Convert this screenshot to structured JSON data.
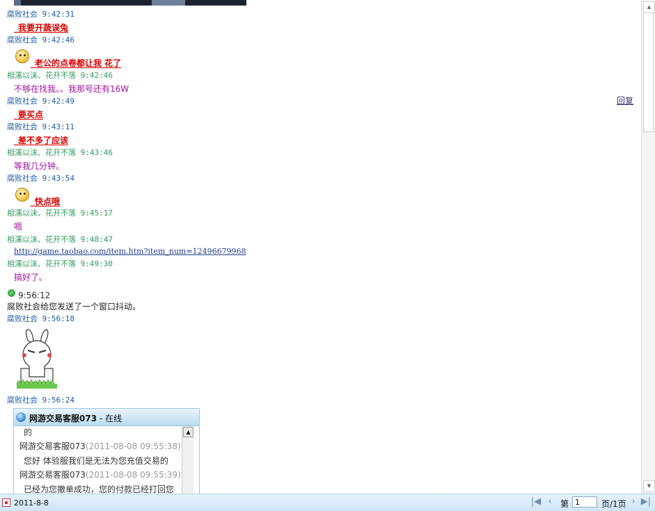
{
  "messages": [
    {
      "sender": "腐败社会",
      "time": "9:42:31",
      "text": "_我要开蔬误兔",
      "style": "red"
    },
    {
      "sender": "腐败社会",
      "time": "9:42:46",
      "text": "_老公的点卷都让我 花了",
      "style": "red",
      "emoji": "sad-face"
    },
    {
      "sender": "相濡以沫、花开不落",
      "time": "9:42:46",
      "text": "不够在找我。。我那号还有16W",
      "style": "pink"
    },
    {
      "sender": "腐败社会",
      "time": "9:42:49",
      "text": "_要买点",
      "style": "red"
    },
    {
      "sender": "腐败社会",
      "time": "9:43:11",
      "text": "_差不多了应该",
      "style": "red"
    },
    {
      "sender": "相濡以沫、花开不落",
      "time": "9:43:46",
      "text": "等我几分钟。",
      "style": "pink"
    },
    {
      "sender": "腐败社会",
      "time": "9:43:54",
      "text": "_快点哦",
      "style": "red",
      "emoji": "surprised-face"
    },
    {
      "sender": "相濡以沫、花开不落",
      "time": "9:45:17",
      "text": "嗯",
      "style": "pink"
    },
    {
      "sender": "相濡以沫、花开不落",
      "time": "9:48:47",
      "text": "http://game.taobao.com/item.htm?item_num=12496679968",
      "style": "link"
    },
    {
      "sender": "相濡以沫、花开不落",
      "time": "9:49:30",
      "text": "搞好了。",
      "style": "pink"
    }
  ],
  "system_notice": {
    "time": "9:56:12",
    "text": "腐败社会给您发送了一个窗口抖动。"
  },
  "sticker_message": {
    "sender": "腐败社会",
    "time": "9:56:18"
  },
  "last_header": {
    "sender": "腐败社会",
    "time": "9:56:24"
  },
  "reply_link": "回复",
  "cs_box": {
    "name": "网游交易客服073",
    "status": " - 在线",
    "lines": [
      {
        "text": "的"
      },
      {
        "sender": "网游交易客服073",
        "meta": "(2011-08-08 09:55:38):"
      },
      {
        "text": "您好 体验服我们是无法为您充值交易的"
      },
      {
        "sender": "网游交易客服073",
        "meta": "(2011-08-08 09:55:39):"
      },
      {
        "text": "已经为您撤单成功，您的付款已经打回您"
      }
    ]
  },
  "status_bar": {
    "date": "2011-8-8",
    "page_prefix": "第",
    "page_value": "1",
    "page_suffix": "页/1页"
  },
  "colors": {
    "blue_sender": "#1a5fa5",
    "green_sender": "#2e9b5b",
    "red_msg": "#d80000",
    "pink_msg": "#a4119d",
    "link": "#1d3e8c"
  }
}
